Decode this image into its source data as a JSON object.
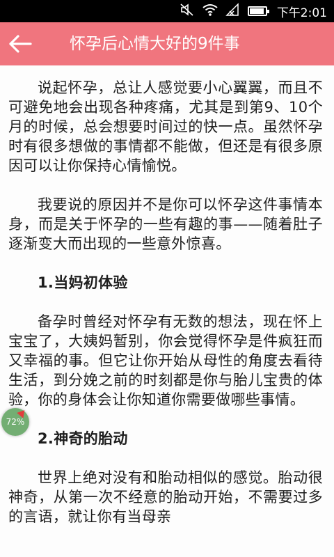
{
  "status_bar": {
    "time": "下午2:01",
    "icons": [
      "mute-icon",
      "wifi-icon",
      "signal-icon",
      "battery-icon"
    ],
    "battery_level": 0.9
  },
  "app_bar": {
    "title": "怀孕后心情大好的9件事",
    "back_icon": "arrow-left-icon",
    "background_color": "#f0757e"
  },
  "article": {
    "paragraphs": [
      "说起怀孕，总让人感觉要小心翼翼，而且不可避免地会出现各种疼痛，尤其是到第9、10个月的时候，总会想要时间过的快一点。虽然怀孕时有很多想做的事情都不能做，但还是有很多原因可以让你保持心情愉悦。",
      "我要说的原因并不是你可以怀孕这件事情本身，而是关于怀孕的一些有趣的事——随着肚子逐渐变大而出现的一些意外惊喜。"
    ],
    "heading1": "1.当妈初体验",
    "paragraph3": "备孕时曾经对怀孕有无数的想法，现在怀上宝宝了，大姨妈暂别，你会觉得怀孕是件疯狂而又幸福的事。但它让你开始从母性的角度去看待生活，到分娩之前的时刻都是你与胎儿宝贵的体验，你的身体会让你知道你需要做哪些事情。",
    "heading2": "2.神奇的胎动",
    "paragraph4": "世界上绝对没有和胎动相似的感觉。胎动很神奇，从第一次不经意的胎动开始，不需要过多的言语，就让你有当母亲"
  },
  "float_badge": {
    "label": "72%",
    "color": "#5aa05a"
  }
}
